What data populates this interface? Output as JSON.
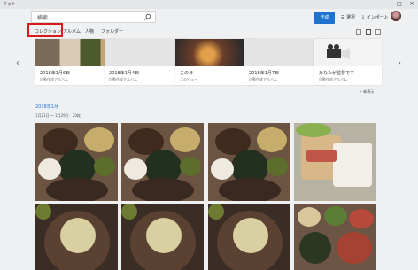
{
  "window": {
    "app_title": "フォト",
    "min": "—",
    "max": "□",
    "close": "✕"
  },
  "toolbar": {
    "search_text": "検索",
    "create_label": "作成",
    "select_label": "選択",
    "import_label": "インポート",
    "more_label": "…"
  },
  "tabs": [
    {
      "label": "コレクション",
      "active": true
    },
    {
      "label": "アルバム"
    },
    {
      "label": "人物"
    },
    {
      "label": "フォルダー"
    }
  ],
  "collections": [
    {
      "date": "2018年1月6日",
      "sub": "自動作成アルバム"
    },
    {
      "date": "2018年1月4日",
      "sub": "自動作成アルバム"
    },
    {
      "date": "この日",
      "sub": "このビュー"
    },
    {
      "date": "2018年1月7日",
      "sub": "自動作成アルバム"
    },
    {
      "date": "あなたが監督です",
      "sub": "自動作成アルバム"
    }
  ],
  "more_link": "＋ 新表示",
  "section": {
    "title": "2018年1月",
    "range": "1月21日 〜 1月29日　20枚"
  },
  "colors": {
    "accent": "#1e73d2",
    "highlight": "#d61a1a"
  },
  "icons": {
    "search": "search-icon",
    "create": "create-icon",
    "left": "chevron-left-icon",
    "right": "chevron-right-icon"
  }
}
